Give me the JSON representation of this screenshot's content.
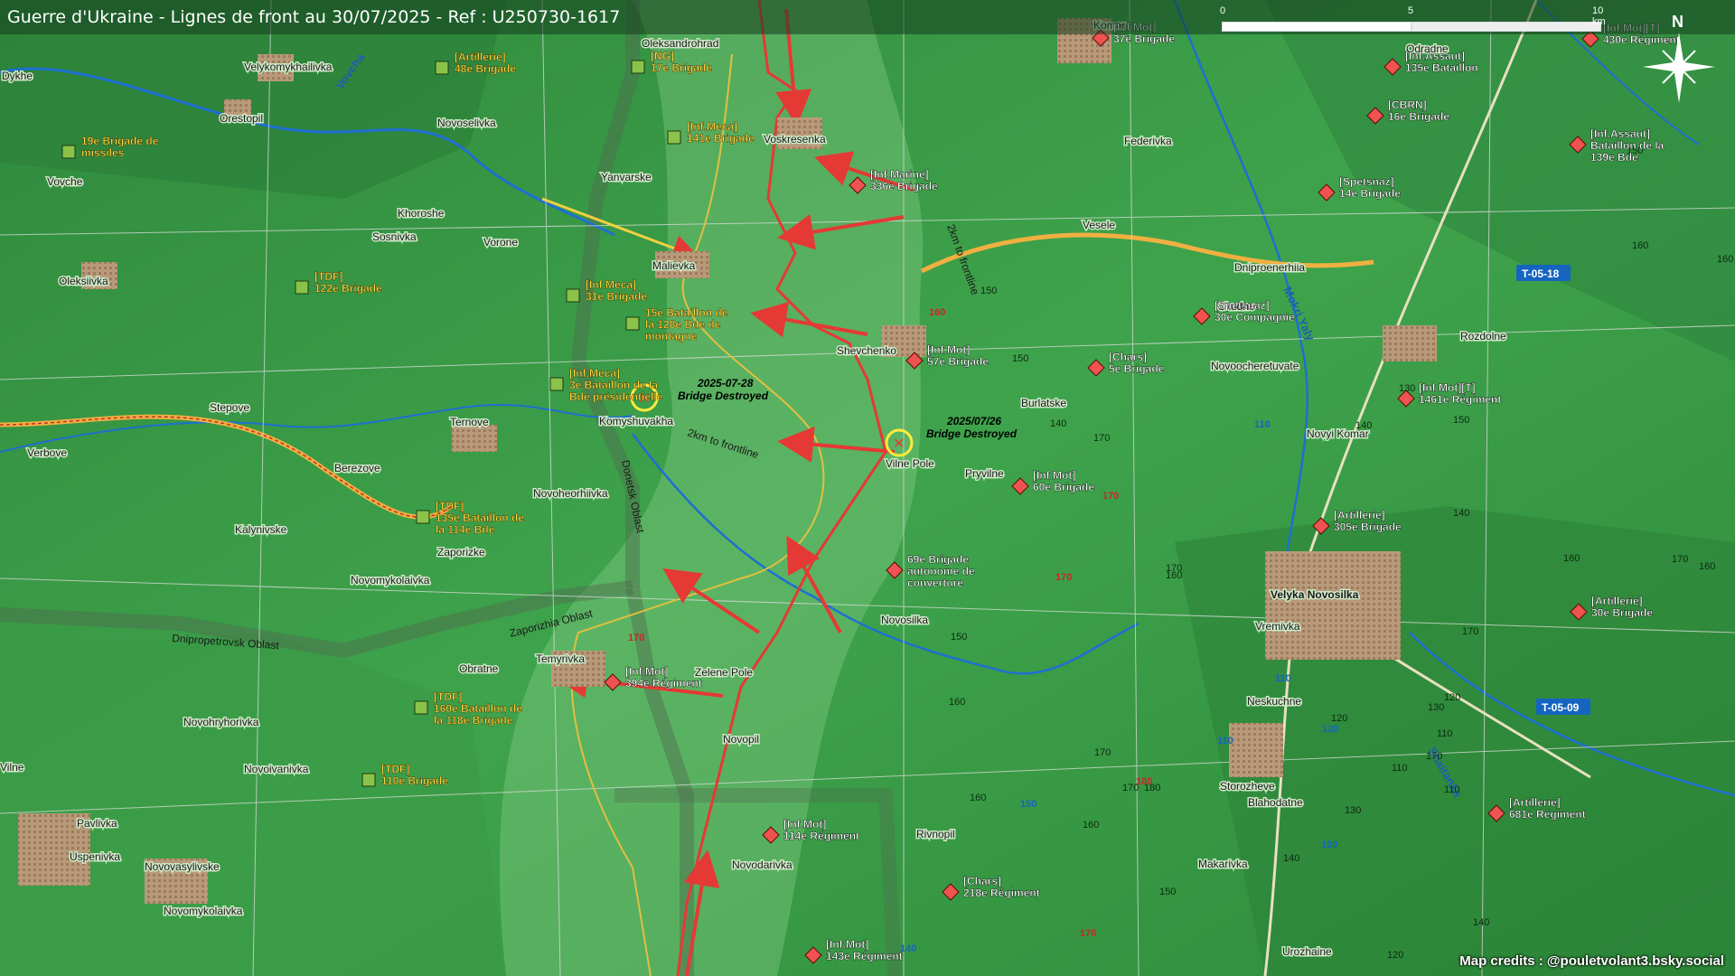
{
  "title": "Guerre d'Ukraine - Lignes de front au 30/07/2025 - Ref : U250730-1617",
  "scale": {
    "l0": "0",
    "l5": "5",
    "l10": "10 km"
  },
  "compass": "N",
  "credits": "Map credits : @pouletvolant3.bsky.social",
  "colors": {
    "russian": "#e53935",
    "ukrainian": "#7cb342",
    "frontline": "#d32f2f",
    "allied_line": "#e0c040",
    "road_label": "#1565c0"
  },
  "oblasts": [
    {
      "name": "Dnipropetrovsk Oblast"
    },
    {
      "name": "Zaporizhia Oblast"
    },
    {
      "name": "Donetsk Oblast"
    }
  ],
  "annotations": [
    {
      "date": "2025-07-28",
      "text": "Bridge Destroyed"
    },
    {
      "date": "2025/07/26",
      "text": "Bridge Destroyed"
    },
    {
      "text": "2km to frontline"
    },
    {
      "text": "2km to frontline"
    }
  ],
  "roads": [
    {
      "label": "T-05-18"
    },
    {
      "label": "T-05-09"
    }
  ],
  "rivers": [
    {
      "name": "Vovcha"
    },
    {
      "name": "Mokri Yaly"
    },
    {
      "name": "Shaitanka"
    }
  ],
  "towns": [
    "Velykomykhailivka",
    "Orestopil",
    "Oleksandrohrad",
    "Novoselivka",
    "Voskresenka",
    "Yanvarske",
    "Vovche",
    "Khoroshe",
    "Sosnivka",
    "Vorone",
    "Malievka",
    "Oleksiivka",
    "Komar",
    "Odradne",
    "Federivka",
    "Vesele",
    "Dniproenerhiia",
    "Skudne",
    "Novoocheretuvate",
    "Rozdolne",
    "Shevchenko",
    "Burlatske",
    "Stepove",
    "Ternove",
    "Komyshuvakha",
    "Verbove",
    "Berezove",
    "Vilne Pole",
    "Pryvilne",
    "Novyi Komar",
    "Novoheorhiivka",
    "Kalynivske",
    "Zaporizke",
    "Novomykolaivka",
    "Velyka Novosilka",
    "Vremivka",
    "Novosilka",
    "Temyrivka",
    "Zelene Pole",
    "Obratne",
    "Neskuchne",
    "Novohryhorivka",
    "Novopil",
    "Storozheve",
    "Blahodatne",
    "Novoivanivka",
    "Pavlivka",
    "Uspenivka",
    "Novovasylivske",
    "Rivnopil",
    "Makarivka",
    "Novodarivka",
    "Novomykolaivka",
    "Urozhaine",
    "Dykhe",
    "Vilne"
  ],
  "ukraine_units": [
    {
      "label": "[Artillerie] 48e Brigade"
    },
    {
      "label": "[NG] 17e Brigade"
    },
    {
      "label": "19e Brigade de missiles"
    },
    {
      "label": "[Inf.Meca] 141e Brigade"
    },
    {
      "label": "[TDF] 122e Brigade"
    },
    {
      "label": "[Inf.Meca] 31e Brigade"
    },
    {
      "label": "[Inf.Meca] 3e Bataillon de la Bde présidentielle"
    },
    {
      "label": "15e Bataillon de la 128e Bde de montagne"
    },
    {
      "label": "[TDF] 135e Bataillon de la 114e Bde"
    },
    {
      "label": "[TDF] 160e Bataillon de la 118e Brigade"
    },
    {
      "label": "[TDF] 110e Brigade"
    }
  ],
  "russia_units": [
    {
      "label": "[Inf.Mot] 37e Brigade"
    },
    {
      "label": "[Inf.Assaut] 135e Bataillon"
    },
    {
      "label": "[Inf.Mot][T] 430e Régiment"
    },
    {
      "label": "[CBRN] 16e Brigade"
    },
    {
      "label": "[Inf.Assaut] Bataillon de la 139e Bde"
    },
    {
      "label": "[Inf.Marine] 336e Brigade"
    },
    {
      "label": "[Spetsnaz] 14e Brigade"
    },
    {
      "label": "[Spetsnaz] 30e Compagnie"
    },
    {
      "label": "[Inf.Mot] 57e Brigade"
    },
    {
      "label": "[Chars] 5e Brigade"
    },
    {
      "label": "[Inf.Mot][T] 1461e Régiment"
    },
    {
      "label": "[Inf.Mot] 60e Brigade"
    },
    {
      "label": "[Artillerie] 305e Brigade"
    },
    {
      "label": "69e Brigade autonome de couverture"
    },
    {
      "label": "[Artillerie] 30e Brigade"
    },
    {
      "label": "[Inf.Mot] 394e Régiment"
    },
    {
      "label": "[Artillerie] 681e Régiment"
    },
    {
      "label": "[Inf.Mot] 114e Régiment"
    },
    {
      "label": "[Chars] 218e Régiment"
    },
    {
      "label": "[Inf.Mot] 143e Régiment"
    }
  ],
  "elevations": [
    "150",
    "160",
    "160",
    "150",
    "150",
    "140",
    "130",
    "140",
    "150",
    "140",
    "160",
    "170",
    "170",
    "160",
    "130",
    "120",
    "110",
    "110",
    "160",
    "170",
    "170",
    "180",
    "160",
    "150",
    "140",
    "120",
    "130",
    "110",
    "120",
    "170",
    "170",
    "170",
    "140",
    "160",
    "160",
    "150"
  ],
  "road_numbers": [
    "110",
    "110",
    "110",
    "120",
    "120",
    "150",
    "140"
  ],
  "red_numbers": [
    "160",
    "170",
    "170",
    "170",
    "180",
    "170"
  ]
}
